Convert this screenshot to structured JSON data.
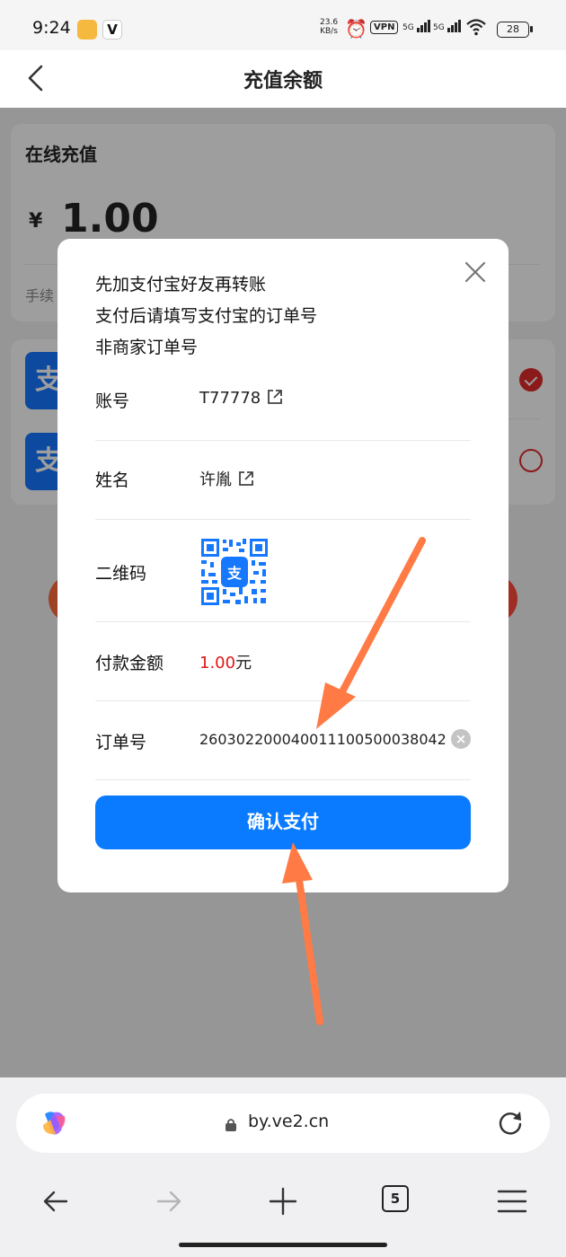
{
  "status_bar": {
    "time": "9:24",
    "net_speed": "23.6",
    "net_speed_unit": "KB/s",
    "vpn": "VPN",
    "signal1": "5G",
    "signal2": "5G",
    "wifi_sub": "6",
    "battery": "28"
  },
  "header": {
    "title": "充值余额"
  },
  "recharge_card": {
    "title": "在线充值",
    "currency": "¥",
    "amount": "1.00",
    "fee_label": "手续"
  },
  "payment_methods": [
    {
      "icon_char": "支",
      "selected": true
    },
    {
      "icon_char": "支",
      "selected": false
    }
  ],
  "modal": {
    "notice_lines": [
      "先加支付宝好友再转账",
      "支付后请填写支付宝的订单号",
      "非商家订单号"
    ],
    "account_label": "账号",
    "account_value": "T77778",
    "name_label": "姓名",
    "name_value": "许胤",
    "qr_label": "二维码",
    "amount_label": "付款金额",
    "amount_value": "1.00",
    "amount_unit": "元",
    "order_label": "订单号",
    "order_value": "260302200040011100500038042",
    "clear_label": "×",
    "confirm_label": "确认支付"
  },
  "browser": {
    "url": "by.ve2.cn",
    "tab_count": "5"
  },
  "colors": {
    "primary_blue": "#0a7bff",
    "alipay_blue": "#1677ff",
    "accent_red": "#e01818",
    "arrow_orange": "#ff7a45"
  }
}
